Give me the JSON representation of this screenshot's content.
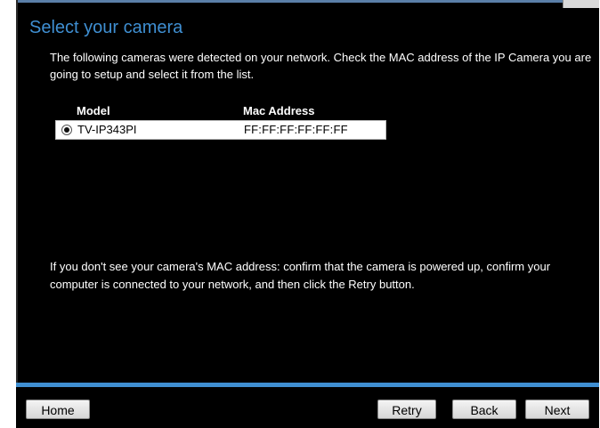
{
  "title": "Select your camera",
  "intro": "The following cameras were detected on your network. Check the MAC address of the IP Camera you are going to setup and select it from the list.",
  "table": {
    "headers": {
      "model": "Model",
      "mac": "Mac Address"
    },
    "rows": [
      {
        "model": "TV-IP343PI",
        "mac": "FF:FF:FF:FF:FF:FF",
        "selected": true
      }
    ]
  },
  "help": "If you don't see your camera's MAC address: confirm that the camera is powered up, confirm your computer is connected to your network, and then click the Retry button.",
  "buttons": {
    "home": "Home",
    "retry": "Retry",
    "back": "Back",
    "next": "Next"
  },
  "colors": {
    "accent": "#3f8fd2",
    "background": "#000000",
    "text": "#ffffff"
  }
}
